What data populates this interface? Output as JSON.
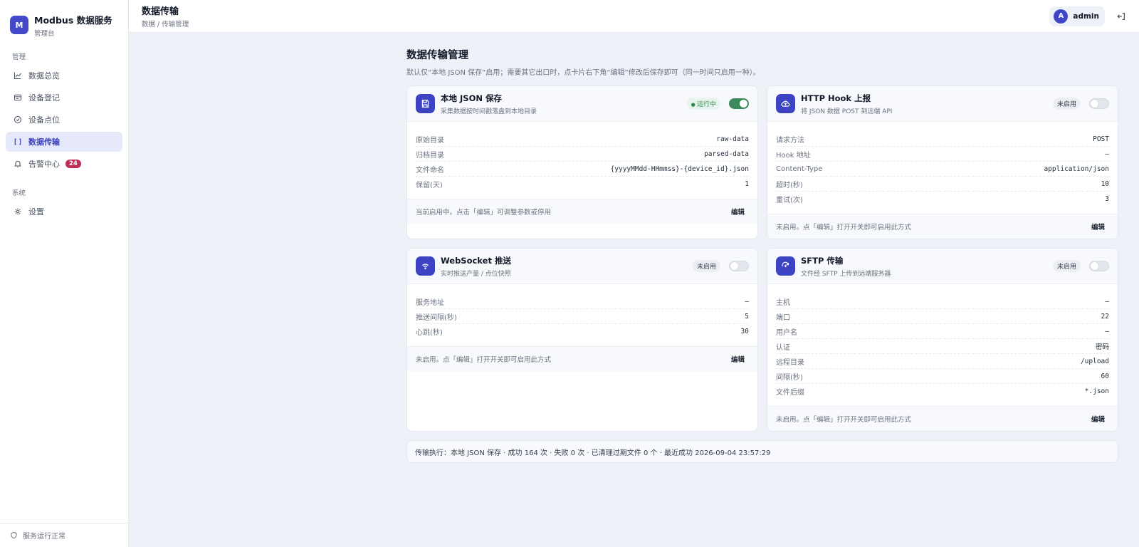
{
  "brand": {
    "logo": "M",
    "title": "Modbus 数据服务",
    "subtitle": "管理台"
  },
  "sidebar": {
    "section_manage": "管理",
    "section_system": "系统",
    "items": [
      {
        "label": "数据总览",
        "icon": "chart-line-icon"
      },
      {
        "label": "设备登记",
        "icon": "id-card-icon"
      },
      {
        "label": "设备点位",
        "icon": "check-circle-icon"
      },
      {
        "label": "数据传输",
        "icon": "transfer-icon",
        "active": true
      },
      {
        "label": "告警中心",
        "icon": "bell-icon",
        "badge": "24"
      },
      {
        "label": "设置",
        "icon": "gear-icon"
      }
    ],
    "footer": "服务运行正常"
  },
  "header": {
    "title": "数据传输",
    "breadcrumb": "数据 / 传输管理",
    "user_initial": "A",
    "user_name": "admin"
  },
  "page": {
    "title": "数据传输管理",
    "description": "默认仅“本地 JSON 保存”启用；需要其它出口时，点卡片右下角“编辑”修改后保存即可（同一时间只启用一种）。"
  },
  "cards": {
    "local": {
      "title": "本地 JSON 保存",
      "subtitle": "采集数据按时间戳落盘到本地目录",
      "status": "运行中",
      "enabled": true,
      "rows": [
        {
          "k": "原始目录",
          "v": "raw-data"
        },
        {
          "k": "归档目录",
          "v": "parsed-data"
        },
        {
          "k": "文件命名",
          "v": "{yyyyMMdd-HHmmss}-{device_id}.json"
        },
        {
          "k": "保留(天)",
          "v": "1"
        }
      ],
      "footer": "当前启用中。点击「编辑」可调整参数或停用",
      "edit": "编辑"
    },
    "http": {
      "title": "HTTP Hook 上报",
      "subtitle": "将 JSON 数据 POST 到远端 API",
      "status": "未启用",
      "enabled": false,
      "rows": [
        {
          "k": "请求方法",
          "v": "POST"
        },
        {
          "k": "Hook 地址",
          "v": "–"
        },
        {
          "k": "Content-Type",
          "v": "application/json"
        },
        {
          "k": "超时(秒)",
          "v": "10"
        },
        {
          "k": "重试(次)",
          "v": "3"
        }
      ],
      "footer": "未启用。点「编辑」打开开关即可启用此方式",
      "edit": "编辑"
    },
    "ws": {
      "title": "WebSocket 推送",
      "subtitle": "实时推送产量 / 点位快照",
      "status": "未启用",
      "enabled": false,
      "rows": [
        {
          "k": "服务地址",
          "v": "–"
        },
        {
          "k": "推送间隔(秒)",
          "v": "5"
        },
        {
          "k": "心跳(秒)",
          "v": "30"
        }
      ],
      "footer": "未启用。点「编辑」打开开关即可启用此方式",
      "edit": "编辑"
    },
    "sftp": {
      "title": "SFTP 传输",
      "subtitle": "文件经 SFTP 上传到远端服务器",
      "status": "未启用",
      "enabled": false,
      "rows": [
        {
          "k": "主机",
          "v": "–"
        },
        {
          "k": "端口",
          "v": "22"
        },
        {
          "k": "用户名",
          "v": "–"
        },
        {
          "k": "认证",
          "v": "密码"
        },
        {
          "k": "远程目录",
          "v": "/upload"
        },
        {
          "k": "间隔(秒)",
          "v": "60"
        },
        {
          "k": "文件后缀",
          "v": "*.json"
        }
      ],
      "footer": "未启用。点「编辑」打开开关即可启用此方式",
      "edit": "编辑"
    }
  },
  "exec_summary": "传输执行：本地 JSON 保存 · 成功 164 次 · 失败 0 次 · 已清理过期文件 0 个 · 最近成功 2026-09-04 23:57:29",
  "colors": {
    "accent": "#3d44c4",
    "active_bg": "#e6e9fa",
    "success": "#3c8a5b",
    "badge": "#be2d55"
  }
}
